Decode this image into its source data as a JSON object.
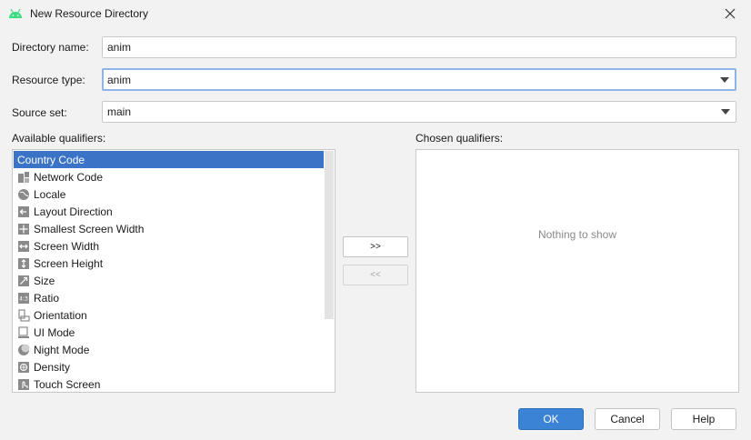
{
  "window": {
    "title": "New Resource Directory"
  },
  "form": {
    "directory_name_label": "Directory name:",
    "directory_name_value": "anim",
    "resource_type_label": "Resource type:",
    "resource_type_value": "anim",
    "source_set_label": "Source set:",
    "source_set_value": "main"
  },
  "qualifiers": {
    "available_label": "Available qualifiers:",
    "chosen_label": "Chosen qualifiers:",
    "items": [
      {
        "label": "Country Code",
        "icon": "country-code-icon",
        "selected": true
      },
      {
        "label": "Network Code",
        "icon": "network-code-icon"
      },
      {
        "label": "Locale",
        "icon": "globe-icon"
      },
      {
        "label": "Layout Direction",
        "icon": "layout-direction-icon"
      },
      {
        "label": "Smallest Screen Width",
        "icon": "smallest-screen-width-icon"
      },
      {
        "label": "Screen Width",
        "icon": "screen-width-icon"
      },
      {
        "label": "Screen Height",
        "icon": "screen-height-icon"
      },
      {
        "label": "Size",
        "icon": "size-icon"
      },
      {
        "label": "Ratio",
        "icon": "ratio-icon"
      },
      {
        "label": "Orientation",
        "icon": "orientation-icon"
      },
      {
        "label": "UI Mode",
        "icon": "ui-mode-icon"
      },
      {
        "label": "Night Mode",
        "icon": "night-mode-icon"
      },
      {
        "label": "Density",
        "icon": "density-icon"
      },
      {
        "label": "Touch Screen",
        "icon": "touch-screen-icon"
      }
    ],
    "empty_text": "Nothing to show",
    "add_label": ">>",
    "remove_label": "<<"
  },
  "footer": {
    "ok_label": "OK",
    "cancel_label": "Cancel",
    "help_label": "Help"
  },
  "colors": {
    "accent": "#3b83d4",
    "selection": "#3b74c7",
    "android_green": "#3ddc84"
  }
}
